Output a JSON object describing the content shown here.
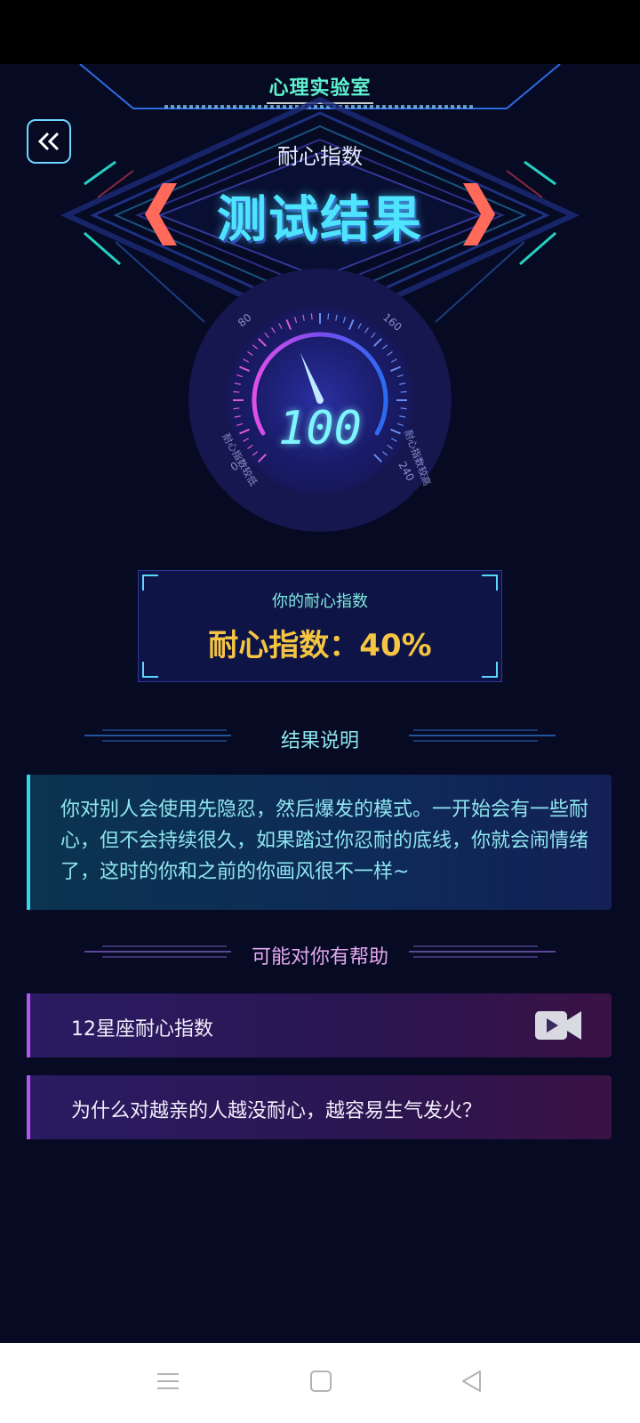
{
  "header": {
    "app_title": "心理实验室",
    "subtitle": "耐心指数",
    "result_title": "测试结果"
  },
  "gauge": {
    "value": "100",
    "ticks": [
      "0",
      "80",
      "160",
      "240"
    ],
    "left_label": "耐心指数较低",
    "right_label": "耐心指数较高"
  },
  "score": {
    "label": "你的耐心指数",
    "value": "耐心指数：40%"
  },
  "explanation": {
    "title": "结果说明",
    "text": "你对别人会使用先隐忍，然后爆发的模式。一开始会有一些耐心，但不会持续很久，如果踏过你忍耐的底线，你就会闹情绪了，这时的你和之前的你画风很不一样~"
  },
  "help": {
    "title": "可能对你有帮助",
    "items": [
      {
        "label": "12星座耐心指数",
        "icon": "video-icon"
      },
      {
        "label": "为什么对越亲的人越没耐心，越容易生气发火？"
      }
    ]
  },
  "colors": {
    "background": "#060a22",
    "accent_cyan": "#4ee3ff",
    "score_gold": "#f4c443",
    "help_purple": "#b455f2"
  }
}
